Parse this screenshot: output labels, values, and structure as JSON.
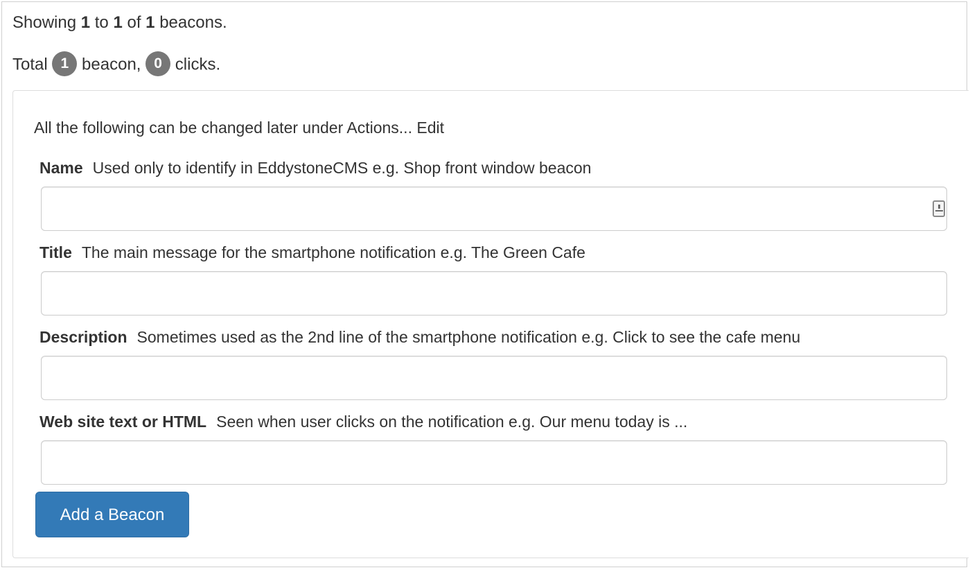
{
  "summary": {
    "showing_prefix": "Showing",
    "showing_from": "1",
    "showing_to_word": "to",
    "showing_to": "1",
    "showing_of_word": "of",
    "showing_total": "1",
    "showing_suffix": "beacons.",
    "total_prefix": "Total",
    "beacon_count": "1",
    "beacon_word": "beacon,",
    "click_count": "0",
    "click_word": "clicks."
  },
  "form": {
    "intro": "All the following can be changed later under Actions... Edit",
    "fields": [
      {
        "label": "Name",
        "hint": "Used only to identify in EddystoneCMS e.g. Shop front window beacon",
        "value": "",
        "icon": "contact-card-icon"
      },
      {
        "label": "Title",
        "hint": "The main message for the smartphone notification e.g. The Green Cafe",
        "value": ""
      },
      {
        "label": "Description",
        "hint": "Sometimes used as the 2nd line of the smartphone notification e.g. Click to see the cafe menu",
        "value": ""
      },
      {
        "label": "Web site text or HTML",
        "hint": "Seen when user clicks on the notification e.g. Our menu today is ...",
        "value": ""
      }
    ],
    "submit_label": "Add a Beacon"
  },
  "colors": {
    "primary_button": "#337ab7",
    "badge": "#777777"
  }
}
